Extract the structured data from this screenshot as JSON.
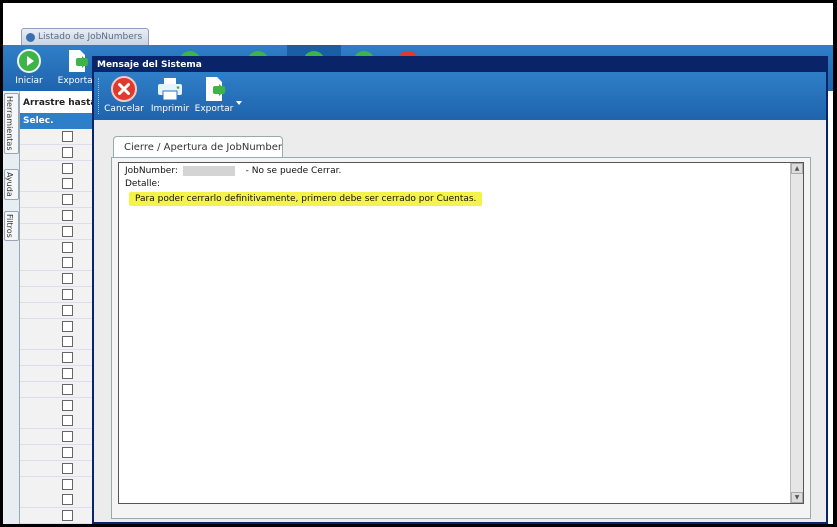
{
  "main_window": {
    "tab_title": "Listado de JobNumbers",
    "toolbar": {
      "iniciar_label": "Iniciar",
      "exportar_label": "Exportar"
    },
    "drag_hint": "Arrastre hasta ac",
    "grid_header": "Selec.",
    "side_tabs": [
      "Herramientas",
      "Ayuda",
      "Filtros"
    ]
  },
  "dialog": {
    "title": "Mensaje del Sistema",
    "toolbar": {
      "cancel_label": "Cancelar",
      "print_label": "Imprimir",
      "export_label": "Exportar"
    },
    "tab_label": "Cierre / Apertura de JobNumber",
    "jobnumber_label": "JobNumber:",
    "status_text": "- No se puede Cerrar.",
    "detail_label": "Detalle:",
    "detail_text": "Para poder cerrarlo definitivamente, primero debe ser cerrado por Cuentas."
  },
  "colors": {
    "toolbar_blue": "#2a75c2",
    "dialog_title": "#0a246a",
    "highlight": "#f3f34a",
    "cancel_red": "#e03a2e",
    "start_green": "#3db34a"
  }
}
